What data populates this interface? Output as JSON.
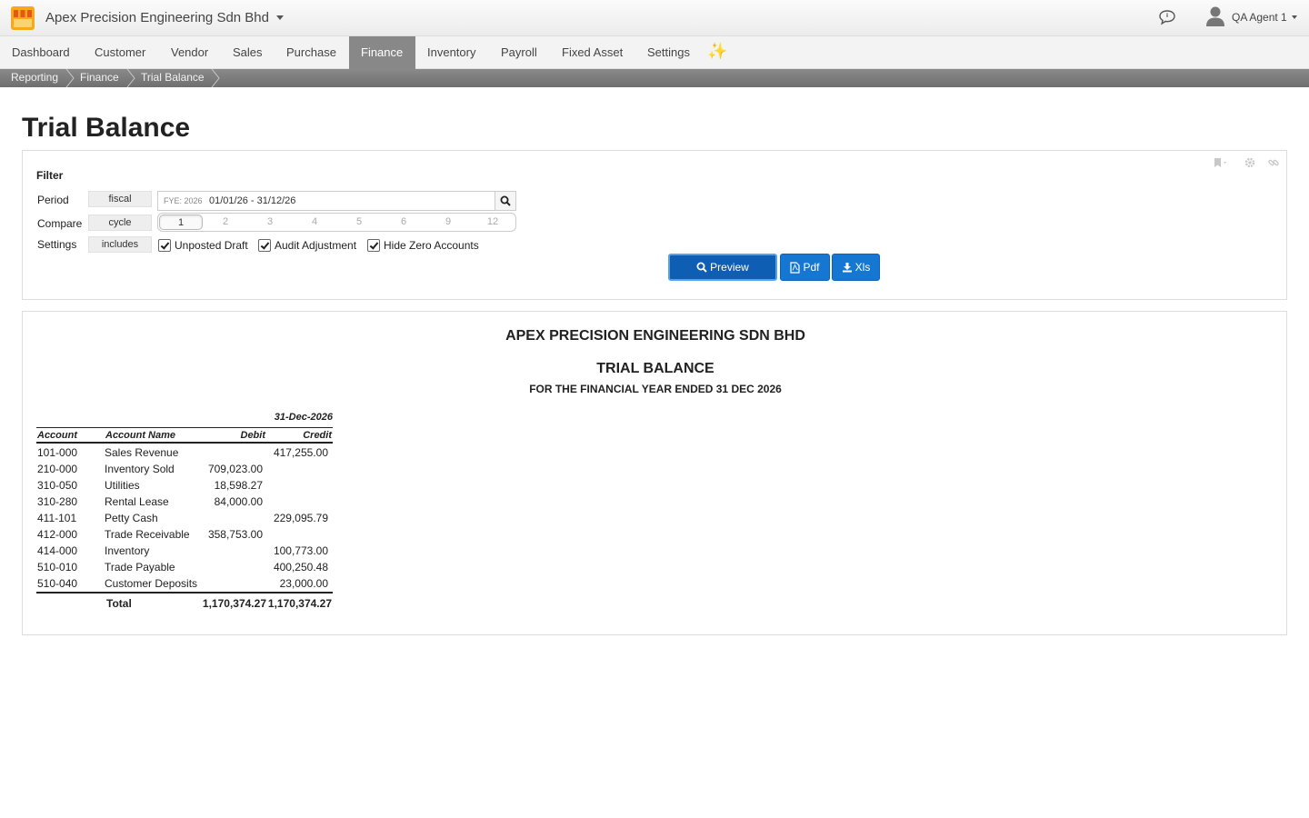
{
  "header": {
    "company": "Apex Precision Engineering Sdn Bhd",
    "user": "QA Agent 1"
  },
  "nav": {
    "items": [
      {
        "label": "Dashboard"
      },
      {
        "label": "Customer"
      },
      {
        "label": "Vendor"
      },
      {
        "label": "Sales"
      },
      {
        "label": "Purchase"
      },
      {
        "label": "Finance",
        "active": true
      },
      {
        "label": "Inventory"
      },
      {
        "label": "Payroll"
      },
      {
        "label": "Fixed Asset"
      },
      {
        "label": "Settings"
      }
    ]
  },
  "breadcrumb": [
    "Reporting",
    "Finance",
    "Trial Balance"
  ],
  "page": {
    "title": "Trial Balance"
  },
  "filter": {
    "heading": "Filter",
    "period": {
      "label": "Period",
      "tag": "fiscal",
      "fye": "FYE: 2026",
      "value": "01/01/26 - 31/12/26"
    },
    "compare": {
      "label": "Compare",
      "tag": "cycle",
      "options": [
        "1",
        "2",
        "3",
        "4",
        "5",
        "6",
        "9",
        "12"
      ],
      "selected": "1"
    },
    "settings": {
      "label": "Settings",
      "tag": "includes",
      "checks": [
        {
          "label": "Unposted Draft",
          "checked": true
        },
        {
          "label": "Audit Adjustment",
          "checked": true
        },
        {
          "label": "Hide Zero Accounts",
          "checked": true
        }
      ]
    },
    "buttons": {
      "preview": "Preview",
      "pdf": "Pdf",
      "xls": "Xls"
    }
  },
  "report": {
    "company": "APEX PRECISION ENGINEERING SDN BHD",
    "title": "TRIAL BALANCE",
    "subtitle": "FOR THE FINANCIAL YEAR ENDED 31 DEC 2026",
    "date": "31-Dec-2026",
    "columns": {
      "account": "Account",
      "name": "Account Name",
      "debit": "Debit",
      "credit": "Credit"
    },
    "rows": [
      {
        "account": "101-000",
        "name": "Sales Revenue",
        "debit": "",
        "credit": "417,255.00"
      },
      {
        "account": "210-000",
        "name": "Inventory Sold",
        "debit": "709,023.00",
        "credit": ""
      },
      {
        "account": "310-050",
        "name": "Utilities",
        "debit": "18,598.27",
        "credit": ""
      },
      {
        "account": "310-280",
        "name": "Rental Lease",
        "debit": "84,000.00",
        "credit": ""
      },
      {
        "account": "411-101",
        "name": "Petty Cash",
        "debit": "",
        "credit": "229,095.79"
      },
      {
        "account": "412-000",
        "name": "Trade Receivable",
        "debit": "358,753.00",
        "credit": ""
      },
      {
        "account": "414-000",
        "name": "Inventory",
        "debit": "",
        "credit": "100,773.00"
      },
      {
        "account": "510-010",
        "name": "Trade Payable",
        "debit": "",
        "credit": "400,250.48"
      },
      {
        "account": "510-040",
        "name": "Customer Deposits",
        "debit": "",
        "credit": "23,000.00"
      }
    ],
    "total": {
      "label": "Total",
      "debit": "1,170,374.27",
      "credit": "1,170,374.27"
    }
  }
}
